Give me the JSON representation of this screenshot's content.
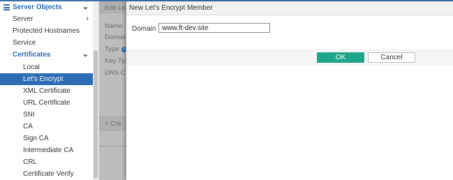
{
  "sidebar": {
    "group": {
      "label": "Server Objects",
      "icon": "server-objects-icon"
    },
    "items": [
      {
        "label": "Server",
        "chevron": "chevron-right-icon"
      },
      {
        "label": "Protected Hostnames"
      },
      {
        "label": "Service"
      },
      {
        "label": "Certificates",
        "chevron": "chevron-down-icon"
      },
      {
        "label": "Local"
      },
      {
        "label": "Let's Encrypt",
        "active": true
      },
      {
        "label": "XML Certificate"
      },
      {
        "label": "URL Certificate"
      },
      {
        "label": "SNI"
      },
      {
        "label": "CA"
      },
      {
        "label": "Sign CA"
      },
      {
        "label": "Intermediate CA"
      },
      {
        "label": "CRL"
      },
      {
        "label": "Certificate Verify"
      }
    ]
  },
  "background_panel": {
    "title": "Edit Let",
    "fields": [
      "Name",
      "Domain",
      "Type",
      "Key Typ",
      "DNS Co"
    ],
    "create_label": "+ Cre"
  },
  "dialog": {
    "title": "New Let's Encrypt Member",
    "domain_label": "Domain",
    "domain_value": "www.ft-dev.site",
    "ok_label": "OK",
    "cancel_label": "Cancel"
  },
  "colors": {
    "accent": "#2d6db5",
    "ok_button": "#1ea58a",
    "overlay": "#bdbdbd"
  }
}
